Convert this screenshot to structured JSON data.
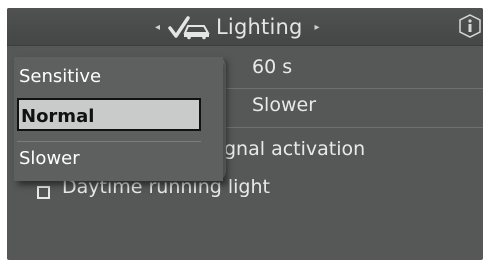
{
  "header": {
    "title": "Lighting",
    "left_arrow": "◂",
    "right_arrow": "▸",
    "car_icon": "car-light-check-icon",
    "info_icon": "info-icon"
  },
  "settings": {
    "row1_value": "60 s",
    "row2_value": "Slower",
    "row3_label": "gnal activation",
    "daytime_label": "Daytime running light"
  },
  "dropdown": {
    "options": [
      "Sensitive",
      "Normal",
      "Slower"
    ],
    "selected": "Normal"
  },
  "colors": {
    "background": "#555857",
    "highlight": "#c8cbca",
    "text": "#e8eaea"
  }
}
